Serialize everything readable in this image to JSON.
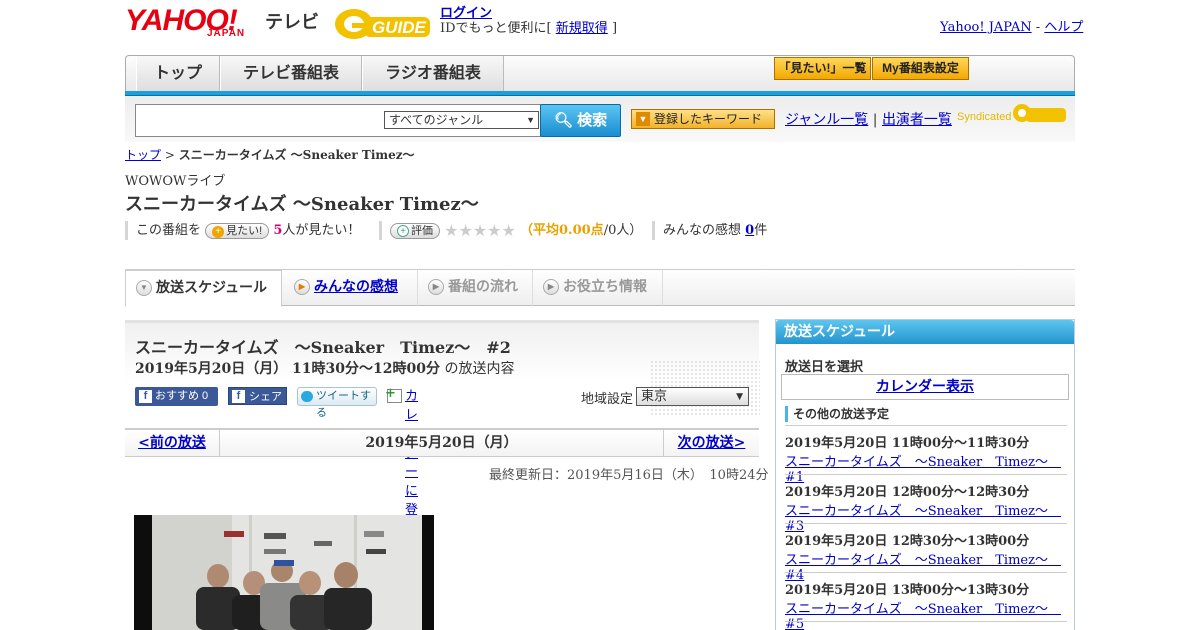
{
  "header": {
    "yahoo_logo": "YAHOO!",
    "japan_logo": "JAPAN",
    "tv_label": "テレビ",
    "gguide_logo": "GUIDE",
    "login_label": "ログイン",
    "id_text": "IDでもっと便利に[",
    "register_label": "新規取得",
    "id_text_end": "]",
    "yahoo_japan_link": "Yahoo! JAPAN",
    "sep": "-",
    "help_link": "ヘルプ"
  },
  "nav": {
    "tabs": [
      "トップ",
      "テレビ番組表",
      "ラジオ番組表"
    ],
    "mitai_list": "「見たい!」一覧",
    "my_settings": "My番組表設定"
  },
  "search": {
    "genre_value": "すべてのジャンル",
    "button_label": "検索",
    "keyword_button": "登録したキーワード",
    "genre_list": "ジャンル一覧",
    "link_sep": "|",
    "performer_list": "出演者一覧",
    "syndicated": "Syndicated"
  },
  "breadcrumb": {
    "top": "トップ",
    "sep": ">",
    "current": "スニーカータイムズ ～Sneaker Timez～"
  },
  "program": {
    "channel": "WOWOWライブ",
    "title": "スニーカータイムズ ～Sneaker Timez～",
    "mitai_prefix": "この番組を",
    "mitai_btn": "見たい!",
    "mitai_count": "5",
    "mitai_suffix": "人が見たい！",
    "rate_btn": "評価",
    "stars": "★★★★★",
    "avg_open": "（",
    "avg_label": "平均0.00点",
    "avg_people": "/0人）",
    "comments_prefix": "みんなの感想",
    "comments_count": "0",
    "comments_suffix": "件"
  },
  "subtabs": [
    "放送スケジュール",
    "みんなの感想",
    "番組の流れ",
    "お役立ち情報"
  ],
  "detail": {
    "title": "スニーカータイムズ　～Sneaker　Timez～　#2",
    "time": "2019年5月20日（月）  11時30分～12時00分",
    "time_suffix": "の放送内容",
    "fb_recommend": "おすすめ 0",
    "fb_share": "シェア",
    "tweet": "ツイートする",
    "calendar": "カレンダーに登録",
    "region_label": "地域設定",
    "region_value": "東京",
    "prev": "<前の放送",
    "date": "2019年5月20日（月）",
    "next": "次の放送>",
    "updated": "最終更新日：2019年5月16日（木）　10時24分"
  },
  "side": {
    "heading": "放送スケジュール",
    "select_date": "放送日を選択",
    "calendar_btn": "カレンダー表示",
    "other_heading": "その他の放送予定",
    "items": [
      {
        "time": "2019年5月20日  11時00分～11時30分",
        "title": "スニーカータイムズ　～Sneaker　Timez～　#1"
      },
      {
        "time": "2019年5月20日  12時00分～12時30分",
        "title": "スニーカータイムズ　～Sneaker　Timez～　#3"
      },
      {
        "time": "2019年5月20日  12時30分～13時00分",
        "title": "スニーカータイムズ　～Sneaker　Timez～　#4"
      },
      {
        "time": "2019年5月20日  13時00分～13時30分",
        "title": "スニーカータイムズ　～Sneaker　Timez～　#5"
      }
    ]
  },
  "colors": {
    "yahoo_red": "#e60012",
    "accent_blue": "#1ba0de",
    "link": "#0000cc",
    "gguide_yellow": "#f2c200"
  }
}
